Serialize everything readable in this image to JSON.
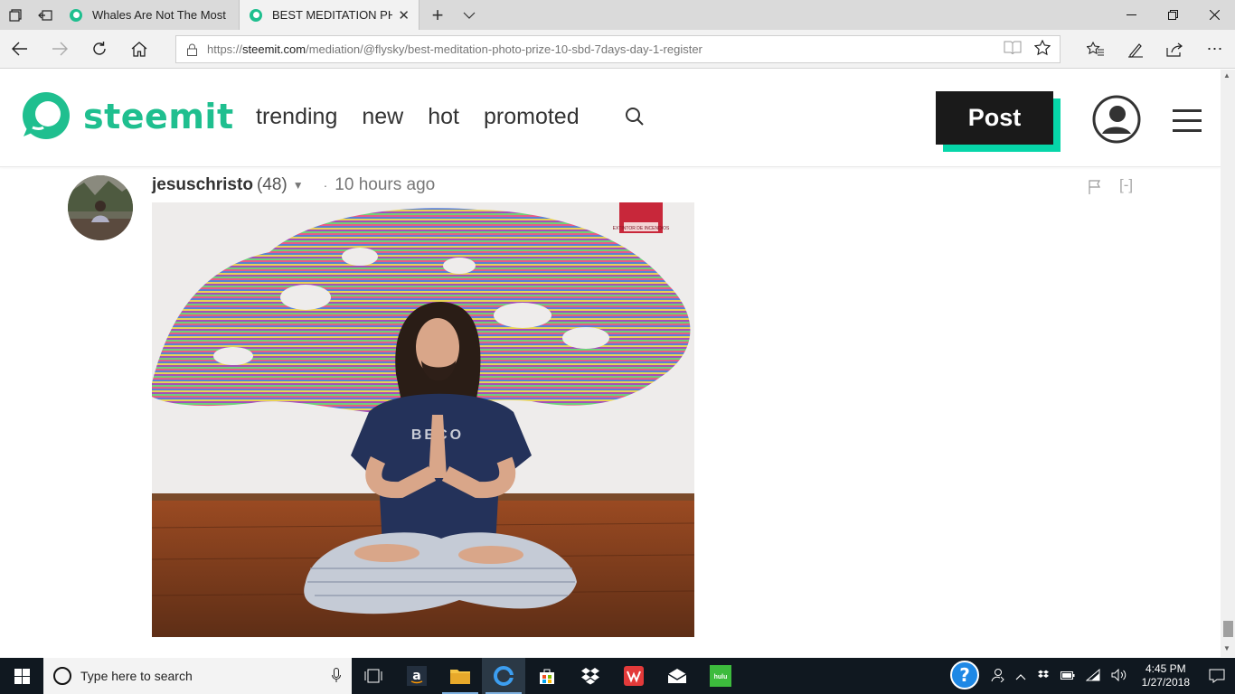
{
  "browser": {
    "tabs": [
      {
        "title": "Whales Are Not The Most Ir",
        "active": false
      },
      {
        "title": "BEST MEDITATION PHO",
        "active": true
      }
    ],
    "url": {
      "scheme": "https://",
      "domain": "steemit.com",
      "path": "/mediation/@flysky/best-meditation-photo-prize-10-sbd-7days-day-1-register"
    }
  },
  "site": {
    "logo_text": "steemit",
    "brand_color": "#1fbf8f",
    "nav": [
      "trending",
      "new",
      "hot",
      "promoted"
    ],
    "post_label": "Post",
    "post_accent": "#06d6a9"
  },
  "comment": {
    "author": "jesuschristo",
    "reputation": "(48)",
    "separator": "·",
    "age": "10 hours ago",
    "collapse": "[-]"
  },
  "photo": {
    "shirt_text": "BECO",
    "sign_text": "EXTINTOR DE INCENDIOS"
  },
  "taskbar": {
    "search_placeholder": "Type here to search",
    "time": "4:45 PM",
    "date": "1/27/2018",
    "hulu_label": "hulu"
  }
}
